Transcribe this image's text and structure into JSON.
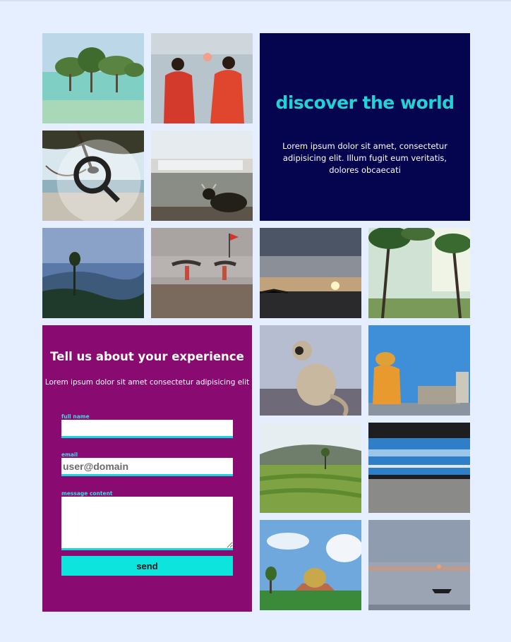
{
  "hero": {
    "title": "discover the world",
    "text": "Lorem ipsum dolor sit amet, consectetur adipisicing elit. Illum fugit eum veritatis, dolores obcaecati"
  },
  "form": {
    "title": "Tell us about your experience",
    "subtitle": "Lorem ipsum dolor sit amet consectetur adipisicing elit",
    "fullname_label": "full name",
    "email_label": "email",
    "email_placeholder": "user@domain",
    "message_label": "message content",
    "send_label": "send"
  },
  "icons": {
    "search": "search-icon"
  },
  "colors": {
    "page_bg": "#e6efff",
    "hero_bg": "#04044f",
    "hero_title": "#22d3d6",
    "form_bg": "#890a70",
    "accent": "#0ee4de"
  }
}
